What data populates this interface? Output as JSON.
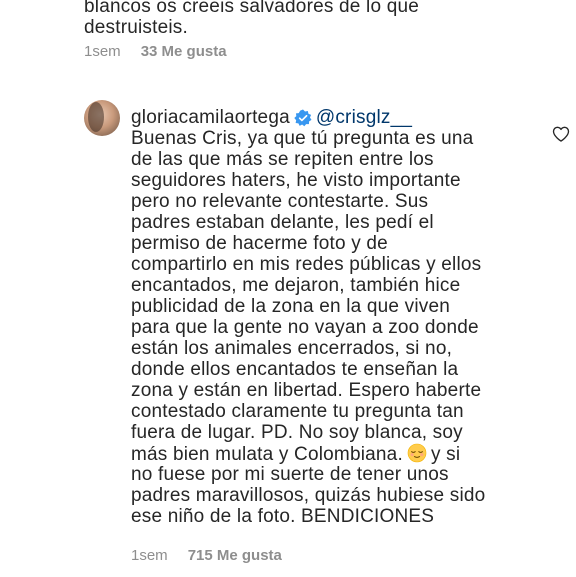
{
  "previous_comment": {
    "lines": [
      "blancos os creeis salvadores de lo que",
      "destruisteis."
    ],
    "time": "1sem",
    "likes": "33 Me gusta"
  },
  "comment": {
    "username": "gloriacamilaortega",
    "mention": "@crisglz__",
    "lines": [
      "Buenas Cris, ya que tú pregunta es una",
      "de las que más se repiten entre los",
      "seguidores haters, he visto importante",
      "pero no relevante contestarte. Sus",
      "padres estaban delante, les pedí el",
      "permiso de hacerme foto y de",
      "compartirlo en mis redes públicas y ellos",
      "encantados, me dejaron, también hice",
      "publicidad de la zona en la que viven",
      "para que la gente no vayan a zoo donde",
      "están los animales encerrados, si no,",
      "donde ellos encantados te enseñan la",
      "zona y están en libertad. Espero haberte",
      "contestado claramente tu pregunta tan",
      "fuera de lugar. PD. No soy blanca, soy"
    ],
    "line_emoji_before": "más bien mulata y Colombiana.",
    "line_emoji_after": "y si",
    "emoji": "relieved-face",
    "lines_after": [
      "no fuese por mi suerte de tener unos",
      "padres maravillosos, quizás hubiese sido",
      "ese niño de la foto.  BENDICIONES"
    ],
    "time": "1sem",
    "likes": "715 Me gusta",
    "icons": [
      "verified-badge-icon",
      "heart-icon"
    ],
    "colors": {
      "verified": "#3897f0",
      "mention": "#00376b",
      "meta": "#8e8e8e",
      "text": "#262626"
    }
  }
}
